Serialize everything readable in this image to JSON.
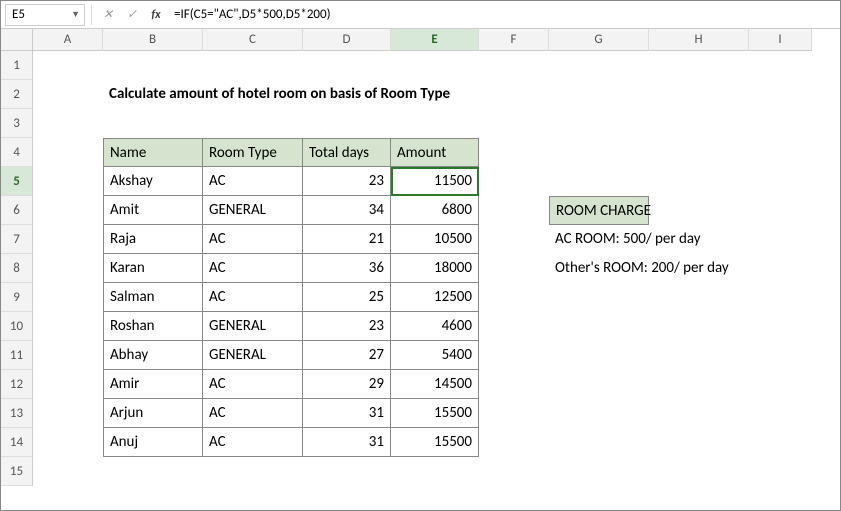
{
  "namebox": {
    "value": "E5"
  },
  "formula": "=IF(C5=\"AC\",D5*500,D5*200)",
  "columns": [
    "A",
    "B",
    "C",
    "D",
    "E",
    "F",
    "G",
    "H",
    "I"
  ],
  "rowcount": 15,
  "selected": {
    "col": "E",
    "row": 5
  },
  "title": "Calculate amount of hotel room on basis of Room Type",
  "headers": {
    "name": "Name",
    "type": "Room Type",
    "days": "Total days",
    "amount": "Amount"
  },
  "rows": [
    {
      "name": "Akshay",
      "type": "AC",
      "days": 23,
      "amount": 11500
    },
    {
      "name": "Amit",
      "type": "GENERAL",
      "days": 34,
      "amount": 6800
    },
    {
      "name": "Raja",
      "type": "AC",
      "days": 21,
      "amount": 10500
    },
    {
      "name": "Karan",
      "type": "AC",
      "days": 36,
      "amount": 18000
    },
    {
      "name": "Salman",
      "type": "AC",
      "days": 25,
      "amount": 12500
    },
    {
      "name": "Roshan",
      "type": "GENERAL",
      "days": 23,
      "amount": 4600
    },
    {
      "name": "Abhay",
      "type": "GENERAL",
      "days": 27,
      "amount": 5400
    },
    {
      "name": "Amir",
      "type": "AC",
      "days": 29,
      "amount": 14500
    },
    {
      "name": "Arjun",
      "type": "AC",
      "days": 31,
      "amount": 15500
    },
    {
      "name": "Anuj",
      "type": "AC",
      "days": 31,
      "amount": 15500
    }
  ],
  "side": {
    "header": "ROOM CHARGE",
    "line1": "AC ROOM: 500/ per day",
    "line2": "Other's ROOM: 200/ per day"
  },
  "chart_data": {
    "type": "table",
    "title": "Calculate amount of hotel room on basis of Room Type",
    "columns": [
      "Name",
      "Room Type",
      "Total days",
      "Amount"
    ],
    "data": [
      [
        "Akshay",
        "AC",
        23,
        11500
      ],
      [
        "Amit",
        "GENERAL",
        34,
        6800
      ],
      [
        "Raja",
        "AC",
        21,
        10500
      ],
      [
        "Karan",
        "AC",
        36,
        18000
      ],
      [
        "Salman",
        "AC",
        25,
        12500
      ],
      [
        "Roshan",
        "GENERAL",
        23,
        4600
      ],
      [
        "Abhay",
        "GENERAL",
        27,
        5400
      ],
      [
        "Amir",
        "AC",
        29,
        14500
      ],
      [
        "Arjun",
        "AC",
        31,
        15500
      ],
      [
        "Anuj",
        "AC",
        31,
        15500
      ]
    ],
    "rules": {
      "AC_per_day": 500,
      "Other_per_day": 200
    }
  }
}
